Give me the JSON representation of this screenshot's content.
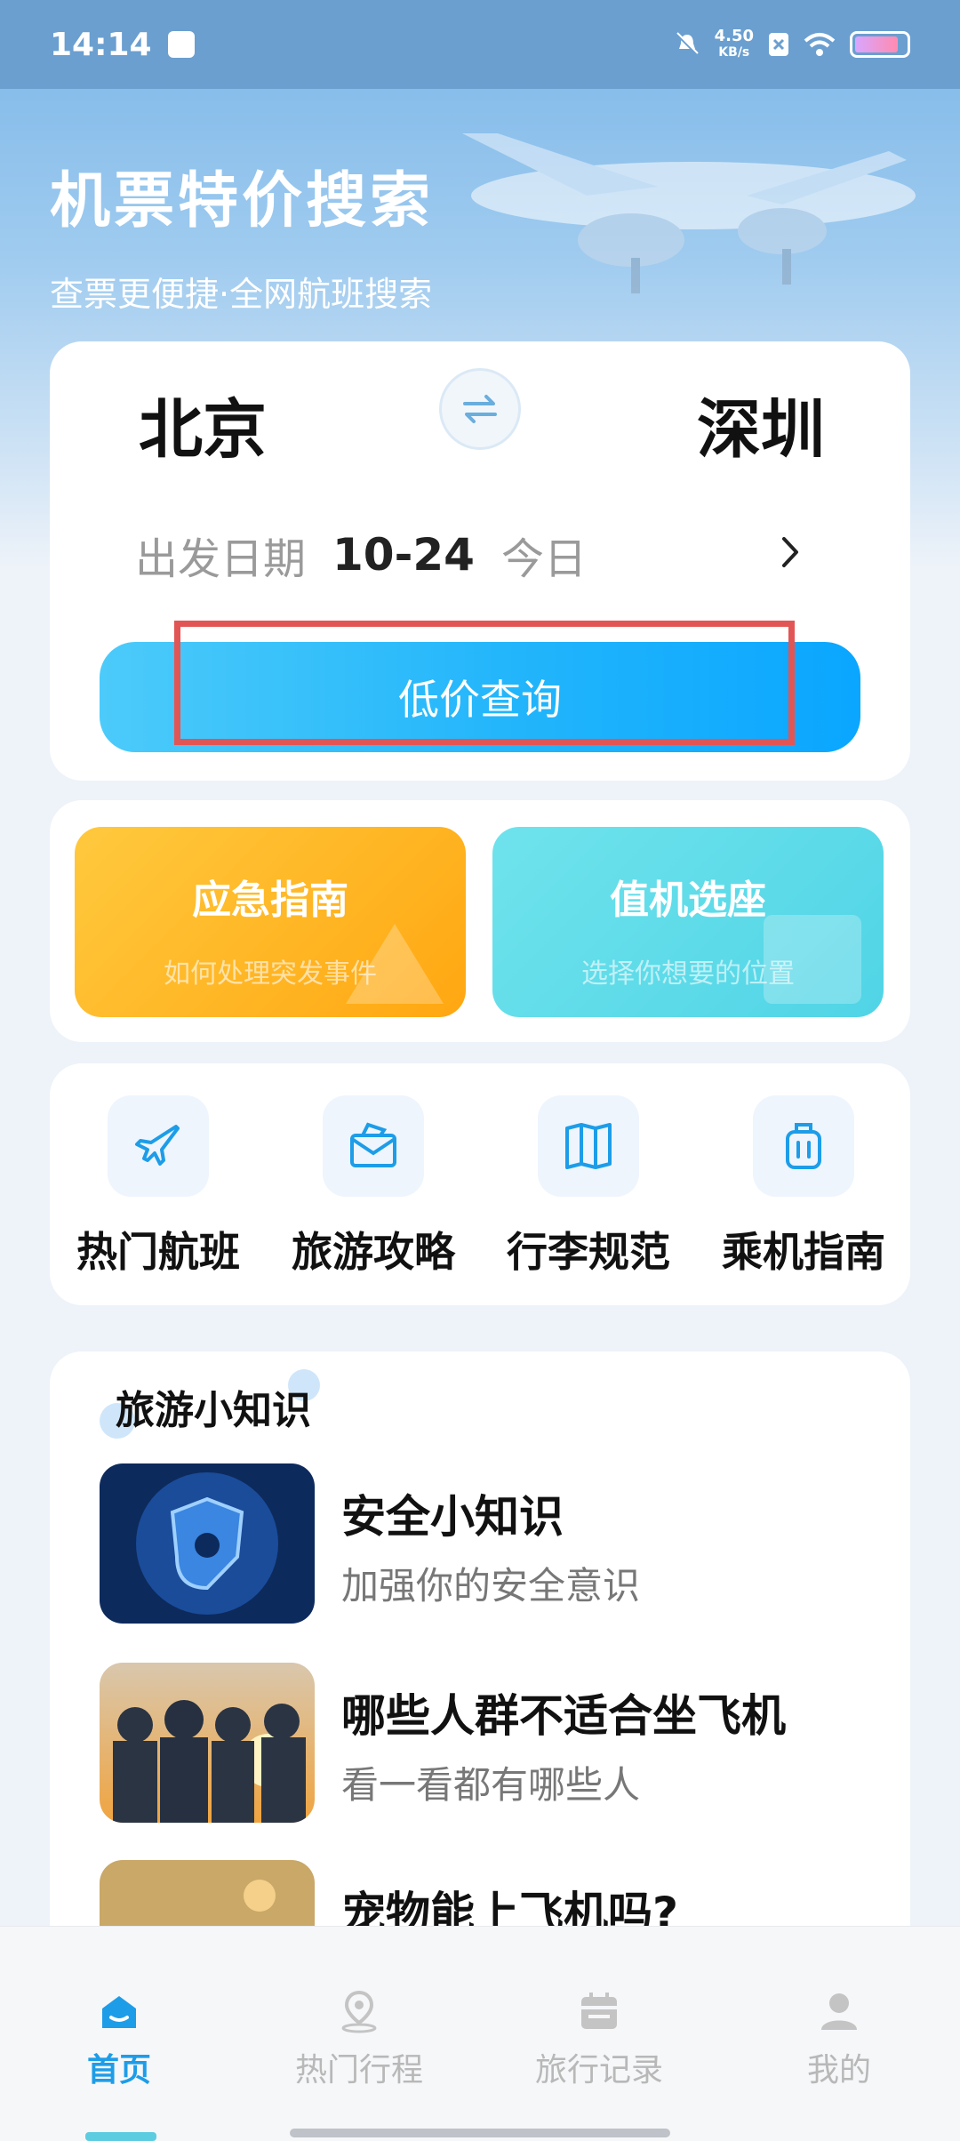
{
  "status_bar": {
    "time": "14:14",
    "net_speed_value": "4.50",
    "net_speed_unit": "KB/s"
  },
  "hero": {
    "title": "机票特价搜索",
    "subtitle": "查票更便捷·全网航班搜索"
  },
  "search": {
    "from_city": "北京",
    "to_city": "深圳",
    "date_label": "出发日期",
    "date_value": "10-24",
    "date_relative": "今日",
    "search_button": "低价查询"
  },
  "guides": [
    {
      "title": "应急指南",
      "subtitle": "如何处理突发事件"
    },
    {
      "title": "值机选座",
      "subtitle": "选择你想要的位置"
    }
  ],
  "nav": [
    {
      "label": "热门航班",
      "icon": "plane-icon"
    },
    {
      "label": "旅游攻略",
      "icon": "map-envelope-icon"
    },
    {
      "label": "行李规范",
      "icon": "book-map-icon"
    },
    {
      "label": "乘机指南",
      "icon": "luggage-icon"
    }
  ],
  "tips": {
    "heading": "旅游小知识",
    "items": [
      {
        "title": "安全小知识",
        "subtitle": "加强你的安全意识"
      },
      {
        "title": "哪些人群不适合坐飞机",
        "subtitle": "看一看都有哪些人"
      },
      {
        "title": "宠物能上飞机吗?",
        "subtitle": ""
      }
    ]
  },
  "tabbar": [
    {
      "label": "首页",
      "icon": "home-icon",
      "active": true
    },
    {
      "label": "热门行程",
      "icon": "location-pin-icon",
      "active": false
    },
    {
      "label": "旅行记录",
      "icon": "calendar-icon",
      "active": false
    },
    {
      "label": "我的",
      "icon": "user-icon",
      "active": false
    }
  ],
  "colors": {
    "accent": "#1d9de8",
    "button_gradient_start": "#4ccbfa",
    "button_gradient_end": "#0aa6ff",
    "emergency_tile": "#ffb21f",
    "checkin_tile": "#5fdbe9",
    "highlight_box": "#e25555"
  }
}
